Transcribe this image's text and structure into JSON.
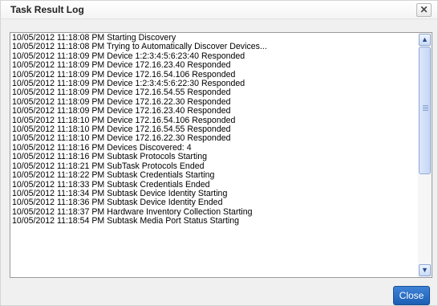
{
  "dialog": {
    "title": "Task Result Log",
    "close_glyph": "✕",
    "close_button_label": "Close"
  },
  "scrollbar": {
    "up_arrow": "▲",
    "down_arrow": "▼"
  },
  "log_lines": [
    "10/05/2012 11:18:08 PM Starting Discovery",
    "10/05/2012 11:18:08 PM Trying to Automatically Discover Devices...",
    "10/05/2012 11:18:09 PM Device 1:2:3:4:5:6:23:40 Responded",
    "10/05/2012 11:18:09 PM Device 172.16.23.40 Responded",
    "10/05/2012 11:18:09 PM Device 172.16.54.106 Responded",
    "10/05/2012 11:18:09 PM Device 1:2:3:4:5:6:22:30 Responded",
    "10/05/2012 11:18:09 PM Device 172.16.54.55 Responded",
    "10/05/2012 11:18:09 PM Device 172.16.22.30 Responded",
    "10/05/2012 11:18:09 PM Device 172.16.23.40 Responded",
    "10/05/2012 11:18:10 PM Device 172.16.54.106 Responded",
    "10/05/2012 11:18:10 PM Device 172.16.54.55 Responded",
    "10/05/2012 11:18:10 PM Device 172.16.22.30 Responded",
    "10/05/2012 11:18:16 PM Devices Discovered: 4",
    "10/05/2012 11:18:16 PM Subtask Protocols Starting",
    "10/05/2012 11:18:21 PM SubTask Protocols Ended",
    "10/05/2012 11:18:22 PM Subtask Credentials Starting",
    "10/05/2012 11:18:33 PM Subtask Credentials Ended",
    "10/05/2012 11:18:34 PM Subtask Device Identity Starting",
    "10/05/2012 11:18:36 PM Subtask Device Identity Ended",
    "10/05/2012 11:18:37 PM Hardware Inventory Collection Starting",
    "10/05/2012 11:18:54 PM Subtask Media Port Status Starting"
  ]
}
